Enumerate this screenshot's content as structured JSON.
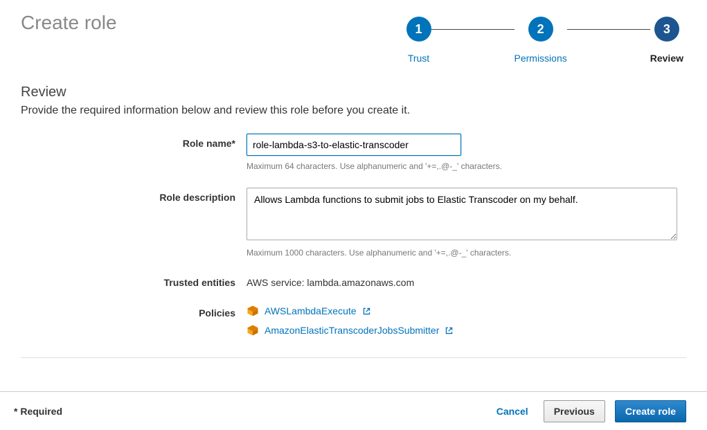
{
  "header": {
    "title": "Create role"
  },
  "steps": {
    "s1": {
      "num": "1",
      "label": "Trust"
    },
    "s2": {
      "num": "2",
      "label": "Permissions"
    },
    "s3": {
      "num": "3",
      "label": "Review"
    }
  },
  "review": {
    "heading": "Review",
    "description": "Provide the required information below and review this role before you create it.",
    "role_name_label": "Role name*",
    "role_name_value": "role-lambda-s3-to-elastic-transcoder",
    "role_name_hint": "Maximum 64 characters. Use alphanumeric and '+=,.@-_' characters.",
    "role_desc_label": "Role description",
    "role_desc_value": "Allows Lambda functions to submit jobs to Elastic Transcoder on my behalf.",
    "role_desc_hint": "Maximum 1000 characters. Use alphanumeric and '+=,.@-_' characters.",
    "trusted_label": "Trusted entities",
    "trusted_value": "AWS service: lambda.amazonaws.com",
    "policies_label": "Policies",
    "policies": [
      {
        "name": "AWSLambdaExecute"
      },
      {
        "name": "AmazonElasticTranscoderJobsSubmitter"
      }
    ]
  },
  "footer": {
    "required": "* Required",
    "cancel": "Cancel",
    "previous": "Previous",
    "create": "Create role"
  }
}
